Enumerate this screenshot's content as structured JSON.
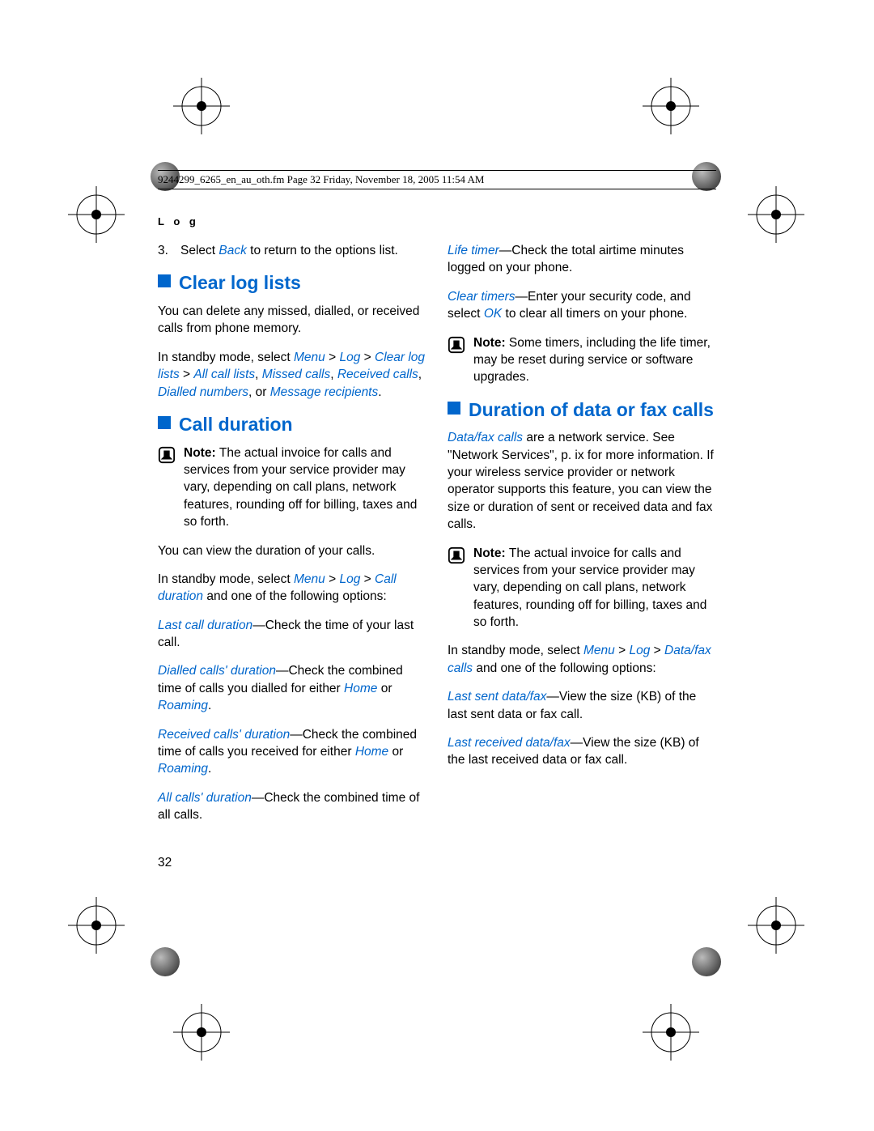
{
  "header": "9244299_6265_en_au_oth.fm  Page 32  Friday, November 18, 2005  11:54 AM",
  "section_label": "L o g",
  "left": {
    "step3_num": "3.",
    "step3_a": "Select ",
    "step3_link": "Back",
    "step3_b": " to return to the options list.",
    "h_clear": "Clear log lists",
    "clear_p": "You can delete any missed, dialled, or received calls from phone memory.",
    "standby_a": "In standby mode, select ",
    "menu": "Menu",
    "gt": " > ",
    "log": "Log",
    "clearloglists": "Clear log lists",
    "allcalllists": "All call lists",
    "missedcalls": "Missed calls",
    "receivedcalls": "Received calls",
    "diallednumbers": "Dialled numbers",
    "or": ", or ",
    "messagerecipients": "Message recipients",
    "period": ".",
    "h_call": "Call duration",
    "note1_bold": "Note: ",
    "note1": "The actual invoice for calls and services from your service provider may vary, depending on call plans, network features, rounding off for billing, taxes and so forth.",
    "view_p": "You can view the duration of your calls.",
    "callduration": "Call duration",
    "standby2_b": " and one of the following options:",
    "lastcall_link": "Last call duration",
    "lastcall_b": "—Check the time of your last call.",
    "dialled_link": "Dialled calls' duration",
    "dialled_b": "—Check the combined time of calls you dialled for either ",
    "home": "Home",
    "or2": " or ",
    "roaming": "Roaming",
    "received_link": "Received calls' duration",
    "received_b": "—Check the combined time of calls you received for either ",
    "allcalls_link": "All calls' duration",
    "allcalls_b": "—Check the combined time of all calls."
  },
  "right": {
    "lifetimer_link": "Life timer",
    "lifetimer_b": "—Check the total airtime minutes logged on your phone.",
    "cleartimers_link": "Clear timers",
    "cleartimers_b": "—Enter your security code, and select ",
    "ok": "OK",
    "cleartimers_c": " to clear all timers on your phone.",
    "note2_bold": "Note: ",
    "note2": "Some timers, including the life timer, may be reset during service or software upgrades.",
    "h_data": "Duration of data or fax calls",
    "datafax_link": "Data/fax calls",
    "data_p": " are a network service. See \"Network Services\", p. ix for more information. If your wireless service provider or network operator supports this feature, you can view the size or duration of sent or received data and fax calls.",
    "note3_bold": "Note: ",
    "note3": "The actual invoice for calls and services from your service provider may vary, depending on call plans, network features, rounding off for billing, taxes and so forth.",
    "standby_a": "In standby mode, select ",
    "menu": "Menu",
    "gt": " > ",
    "log": "Log",
    "standby_b": " and one of the following options:",
    "lastsent_link": "Last sent data/fax",
    "lastsent_b": "—View the size (KB) of the last sent data or fax call.",
    "lastrecv_link": "Last received data/fax",
    "lastrecv_b": "—View the size (KB) of the last received data or fax call."
  },
  "page_number": "32"
}
